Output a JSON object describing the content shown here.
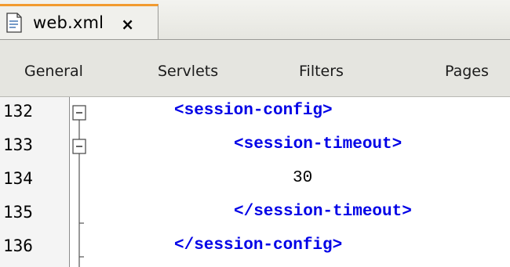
{
  "tab": {
    "title": "web.xml",
    "close_symbol": "×",
    "icon": "xml-document-icon"
  },
  "views": [
    "General",
    "Servlets",
    "Filters",
    "Pages"
  ],
  "lines": [
    {
      "number": "132",
      "text": "<session-config>",
      "fold": "collapse"
    },
    {
      "number": "133",
      "text": "<session-timeout>",
      "fold": "collapse"
    },
    {
      "number": "134",
      "text": "30",
      "fold": "none"
    },
    {
      "number": "135",
      "text": "</session-timeout>",
      "fold": "end"
    },
    {
      "number": "136",
      "text": "</session-config>",
      "fold": "end"
    }
  ],
  "colors": {
    "tag": "#0000e6",
    "accent": "#f29b2f"
  }
}
